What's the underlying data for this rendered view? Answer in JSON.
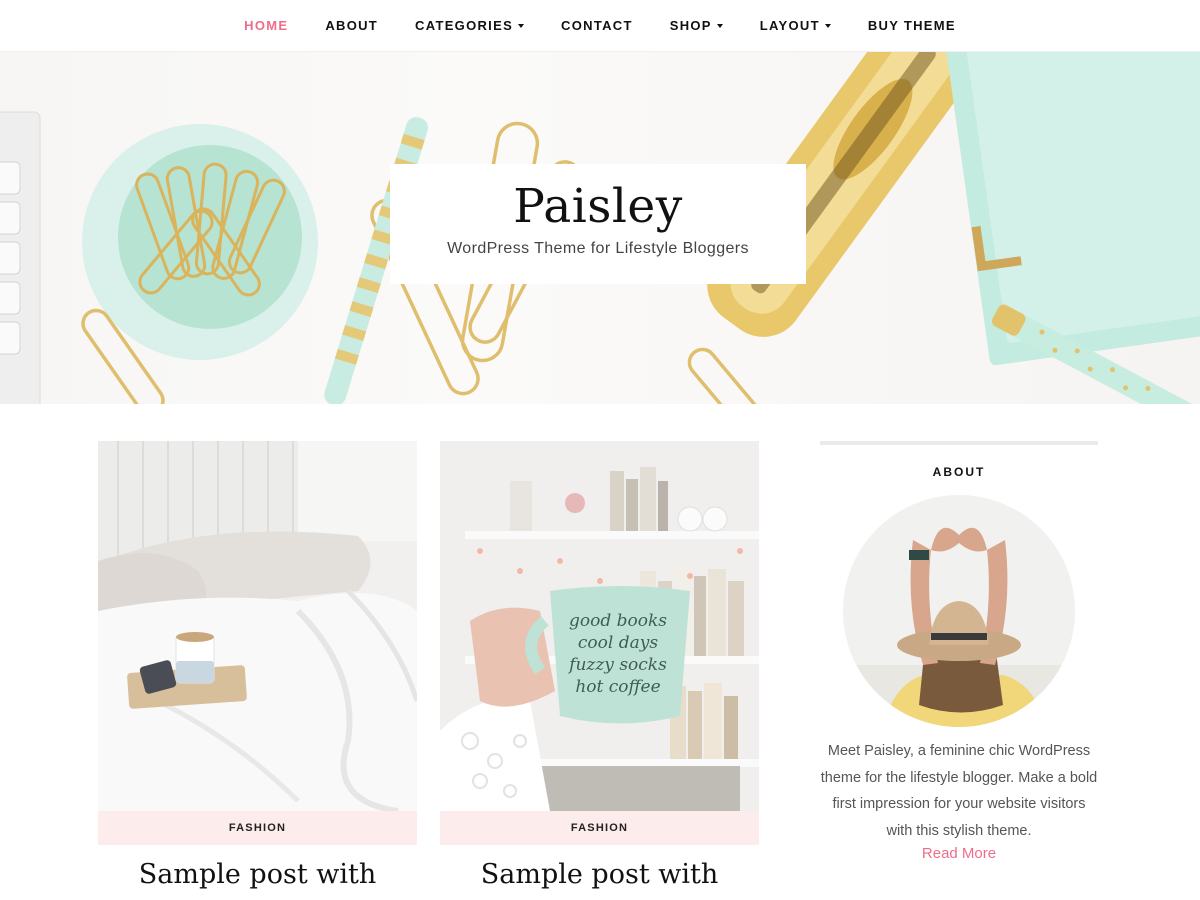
{
  "nav": {
    "items": [
      {
        "label": "HOME",
        "active": true,
        "dropdown": false
      },
      {
        "label": "ABOUT",
        "active": false,
        "dropdown": false
      },
      {
        "label": "CATEGORIES",
        "active": false,
        "dropdown": true
      },
      {
        "label": "CONTACT",
        "active": false,
        "dropdown": false
      },
      {
        "label": "SHOP",
        "active": false,
        "dropdown": true
      },
      {
        "label": "LAYOUT",
        "active": false,
        "dropdown": true
      },
      {
        "label": "BUY THEME",
        "active": false,
        "dropdown": false
      }
    ]
  },
  "hero": {
    "title": "Paisley",
    "tagline": "WordPress Theme for Lifestyle Bloggers"
  },
  "posts": [
    {
      "category": "FASHION",
      "title": "Sample post with"
    },
    {
      "category": "FASHION",
      "title": "Sample post with"
    }
  ],
  "sidebar": {
    "title": "ABOUT",
    "text": "Meet Paisley, a feminine chic WordPress theme for the lifestyle blogger. Make a bold first impression for your website visitors with this stylish theme.",
    "read_more": "Read More"
  },
  "mug_text": [
    "good books",
    "cool days",
    "fuzzy socks",
    "hot coffee"
  ],
  "colors": {
    "accent": "#ef6d8a",
    "category_bg": "#fdecec",
    "mint": "#bfe7dc",
    "gold": "#e2c26a"
  }
}
